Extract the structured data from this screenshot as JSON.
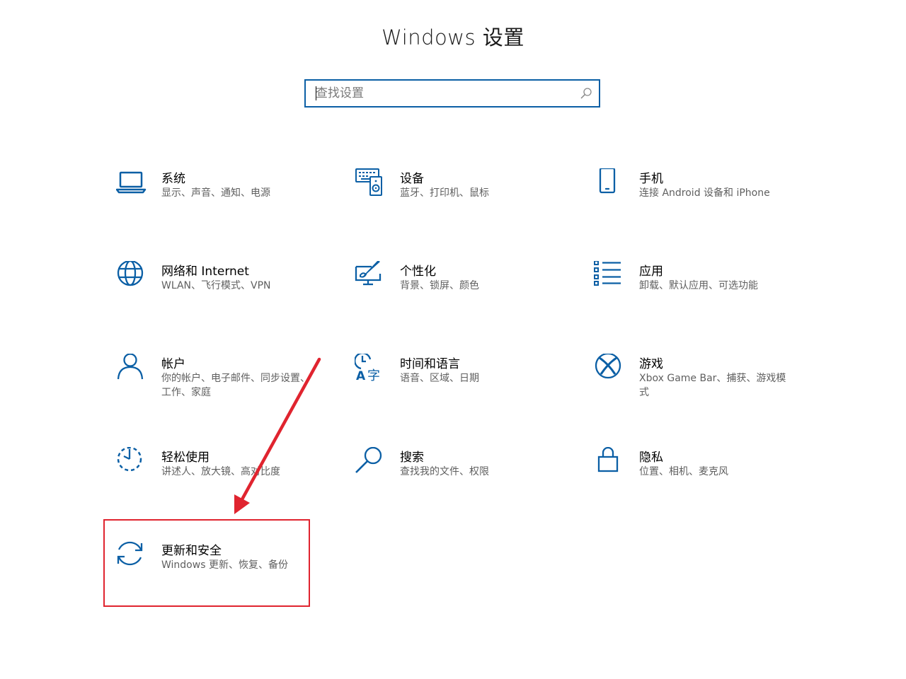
{
  "window": {
    "title": "Windows 设置"
  },
  "search": {
    "placeholder": "查找设置",
    "value": ""
  },
  "categories": [
    {
      "name": "系统",
      "desc": "显示、声音、通知、电源",
      "icon": "laptop-icon"
    },
    {
      "name": "设备",
      "desc": "蓝牙、打印机、鼠标",
      "icon": "devices-icon"
    },
    {
      "name": "手机",
      "desc": "连接 Android 设备和 iPhone",
      "icon": "phone-icon"
    },
    {
      "name": "网络和 Internet",
      "desc": "WLAN、飞行模式、VPN",
      "icon": "globe-icon"
    },
    {
      "name": "个性化",
      "desc": "背景、锁屏、颜色",
      "icon": "personalization-icon"
    },
    {
      "name": "应用",
      "desc": "卸载、默认应用、可选功能",
      "icon": "apps-list-icon"
    },
    {
      "name": "帐户",
      "desc": "你的帐户、电子邮件、同步设置、工作、家庭",
      "icon": "person-icon"
    },
    {
      "name": "时间和语言",
      "desc": "语音、区域、日期",
      "icon": "time-language-icon"
    },
    {
      "name": "游戏",
      "desc": "Xbox Game Bar、捕获、游戏模式",
      "icon": "xbox-icon"
    },
    {
      "name": "轻松使用",
      "desc": "讲述人、放大镜、高对比度",
      "icon": "ease-of-access-icon"
    },
    {
      "name": "搜索",
      "desc": "查找我的文件、权限",
      "icon": "search-icon"
    },
    {
      "name": "隐私",
      "desc": "位置、相机、麦克风",
      "icon": "lock-icon"
    },
    {
      "name": "更新和安全",
      "desc": "Windows 更新、恢复、备份",
      "icon": "sync-icon"
    }
  ],
  "colors": {
    "accent": "#0b5fa5",
    "annotation": "#e0242f"
  }
}
